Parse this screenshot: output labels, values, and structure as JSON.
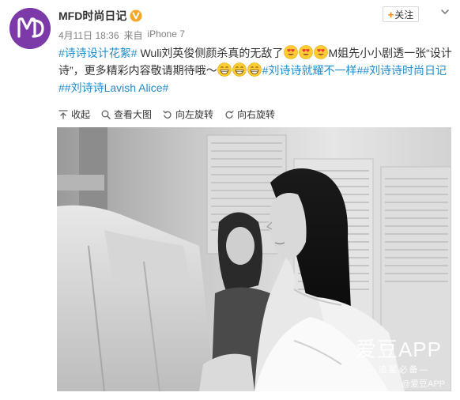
{
  "account": {
    "name": "MFD时尚日记",
    "avatar_text": "M"
  },
  "meta": {
    "date": "4月11日 18:36",
    "source_prefix": "来自",
    "source": "iPhone 7"
  },
  "follow_button": {
    "plus": "+",
    "label": "关注"
  },
  "post": {
    "tag1": "#诗诗设计花絮#",
    "text1": " Wuli刘英俊侧颜杀真的无敌了",
    "text2": "M姐先小小剧透一张“设计诗”，更多精彩内容敬请期待哦～",
    "tag2": "#刘诗诗就耀不一样#",
    "tag3": "#刘诗诗时尚日记#",
    "tag4": "#刘诗诗Lavish Alice#"
  },
  "toolbar": {
    "collapse": "收起",
    "view_large": "查看大图",
    "rotate_left": "向左旋转",
    "rotate_right": "向右旋转"
  },
  "watermark": {
    "big": "爱豆APP",
    "small": "—追星必备—",
    "weibo": "@爱豆APP"
  },
  "colors": {
    "link": "#1f8ccc",
    "follow_plus": "#ff8200",
    "avatar_bg": "#7b3aa8",
    "verify": "#f6a623"
  },
  "icons": [
    "verify-icon",
    "chevron-down-icon",
    "collapse-icon",
    "magnify-icon",
    "rotate-left-icon",
    "rotate-right-icon",
    "grin-emoji-icon",
    "heart-eyes-emoji-icon"
  ]
}
